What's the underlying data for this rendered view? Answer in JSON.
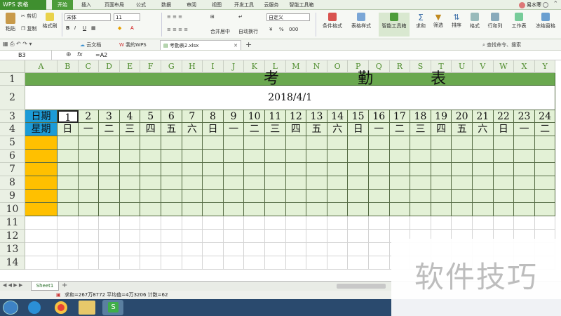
{
  "app": {
    "logo": "WPS 表格",
    "user": "易水寒"
  },
  "ribbon_tabs": [
    "开始",
    "插入",
    "页面布局",
    "公式",
    "数据",
    "审阅",
    "视图",
    "开发工具",
    "云服务",
    "智能工具箱"
  ],
  "ribbon": {
    "paste": "粘贴",
    "cut": "剪切",
    "copy": "复制",
    "format_painter": "格式刷",
    "font_name": "宋体",
    "font_size": "11",
    "number_format": "自定义",
    "merge": "合并居中",
    "wrap": "自动换行",
    "cond_format": "条件格式",
    "table_style": "表格样式",
    "smart_toolbox": "智能工具箱",
    "sum": "求和",
    "filter": "筛选",
    "sort": "排序",
    "format": "格式",
    "row_col": "行和列",
    "worksheet": "工作表",
    "freeze": "冻结窗格",
    "bold": "B",
    "italic": "I",
    "underline": "U",
    "font_color": "A",
    "percent": "%",
    "thousand": "000"
  },
  "doc_tabs": [
    "云文档",
    "我的WPS",
    "考勤表2.xlsx"
  ],
  "search_placeholder": "查找命令、搜索",
  "formula_bar": {
    "cell_ref": "B3",
    "fx": "fx",
    "formula": "=A2"
  },
  "columns": [
    "A",
    "B",
    "C",
    "D",
    "E",
    "F",
    "G",
    "H",
    "I",
    "J",
    "K",
    "L",
    "M",
    "N",
    "O",
    "P",
    "Q",
    "R",
    "S",
    "T",
    "U",
    "V",
    "W",
    "X",
    "Y"
  ],
  "rows": [
    "1",
    "2",
    "3",
    "4",
    "5",
    "6",
    "7",
    "8",
    "9",
    "10",
    "11",
    "12",
    "13",
    "14"
  ],
  "sheet": {
    "title_chars": [
      "考",
      "勤",
      "表"
    ],
    "date": "2018/4/1",
    "date_label": "日期",
    "weekday_label": "星期",
    "days": [
      "1",
      "2",
      "3",
      "4",
      "5",
      "6",
      "7",
      "8",
      "9",
      "10",
      "11",
      "12",
      "13",
      "14",
      "15",
      "16",
      "17",
      "18",
      "19",
      "20",
      "21",
      "22",
      "23",
      "24"
    ],
    "weekdays": [
      "日",
      "一",
      "二",
      "三",
      "四",
      "五",
      "六",
      "日",
      "一",
      "二",
      "三",
      "四",
      "五",
      "六",
      "日",
      "一",
      "二",
      "三",
      "四",
      "五",
      "六",
      "日",
      "一",
      "二"
    ]
  },
  "sheet_tab": "Sheet1",
  "status": "求和=267万8772   平均值=4万3206   计数=62",
  "watermark": "软件技巧",
  "colors": {
    "title_band": "#6aa84f",
    "label_blue": "#1c9bd7",
    "name_orange": "#ffc000",
    "body_green": "#e3f1d6",
    "wps_green": "#3f8f2f"
  }
}
